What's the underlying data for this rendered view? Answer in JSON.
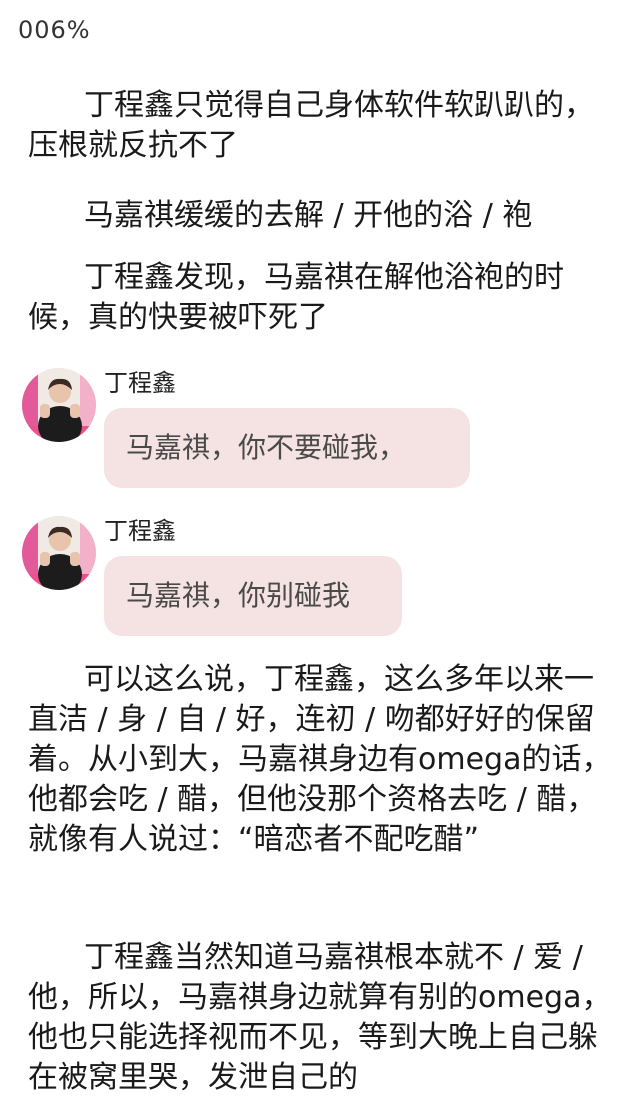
{
  "header": {
    "progress": "006%"
  },
  "story": {
    "p1": "丁程鑫只觉得自己身体软件软趴趴的，压根就反抗不了",
    "p2": "马嘉祺缓缓的去解 / 开他的浴 / 袍",
    "p3": "丁程鑫发现，马嘉祺在解他浴袍的时候，真的快要被吓死了",
    "p4": "可以这么说，丁程鑫，这么多年以来一直洁 / 身 / 自 / 好，连初 / 吻都好好的保留着。从小到大，马嘉祺身边有omega的话，他都会吃 / 醋，但他没那个资格去吃 / 醋，就像有人说过：“暗恋者不配吃醋”",
    "p5": "丁程鑫当然知道马嘉祺根本就不 / 爱 / 他，所以，马嘉祺身边就算有别的omega，他也只能选择视而不见，等到大晚上自己躲在被窝里哭，发泄自己的"
  },
  "chat": [
    {
      "speaker": "丁程鑫",
      "text": "马嘉祺，你不要碰我，",
      "avatar_icon": "person-photo-icon"
    },
    {
      "speaker": "丁程鑫",
      "text": "马嘉祺，你别碰我",
      "avatar_icon": "person-photo-icon"
    }
  ],
  "colors": {
    "bubble": "#f4e3e2",
    "text": "#1a1a1a",
    "bubble_text": "#4a4a4a"
  }
}
